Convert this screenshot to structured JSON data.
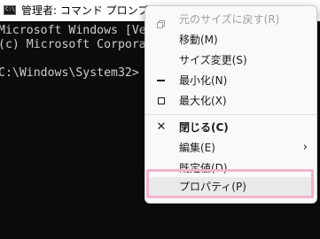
{
  "window": {
    "title": "管理者: コマンド プロンプト",
    "icon_text": "C:\\"
  },
  "console": {
    "lines": [
      "Microsoft Windows [Ve",
      "(c) Microsoft Corpora",
      "",
      "C:\\Windows\\System32>"
    ]
  },
  "context_menu": {
    "items": [
      {
        "label": "元のサイズに戻す(R)",
        "icon": "restore-icon",
        "disabled": true
      },
      {
        "label": "移動(M)",
        "icon": ""
      },
      {
        "label": "サイズ変更(S)",
        "icon": ""
      },
      {
        "label": "最小化(N)",
        "icon": "minimize-icon"
      },
      {
        "label": "最大化(X)",
        "icon": "maximize-icon"
      },
      {
        "label": "閉じる(C)",
        "icon": "close-icon",
        "bold": true
      },
      {
        "label": "編集(E)",
        "icon": "",
        "submenu_arrow": "›"
      },
      {
        "label": "既定値(D)",
        "icon": ""
      },
      {
        "label": "プロパティ(P)",
        "icon": ""
      }
    ],
    "close_glyph": "✕"
  },
  "colors": {
    "console_bg": "#0c0c0c",
    "console_text": "#cccccc",
    "menu_bg": "#f9f9f9",
    "highlight_border": "#f4b3cf"
  }
}
